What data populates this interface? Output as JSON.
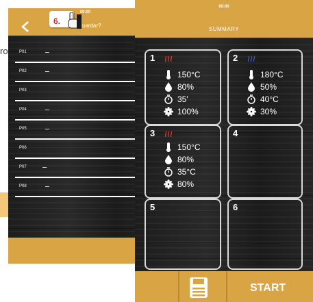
{
  "left_screen": {
    "time": "00:00",
    "title": "uardar?",
    "edge_text": "ro",
    "programs": [
      {
        "label": "P01",
        "value": "---"
      },
      {
        "label": "P02",
        "value": "---"
      },
      {
        "label": "P03",
        "value": ""
      },
      {
        "label": "P04",
        "value": "---"
      },
      {
        "label": "P05",
        "value": "---"
      },
      {
        "label": "P06",
        "value": ""
      },
      {
        "label": "P07",
        "value": "---"
      },
      {
        "label": "P08",
        "value": "---"
      }
    ]
  },
  "step_annotation": "6.",
  "right_screen": {
    "time": "00:00",
    "title": "SUMMARY",
    "phases": [
      {
        "number": "1",
        "mode": "heat",
        "temp": "150°C",
        "humidity": "80%",
        "time": "35'",
        "fan": "100%"
      },
      {
        "number": "2",
        "mode": "steam",
        "temp": "180°C",
        "humidity": "50%",
        "time": "40°C",
        "fan": "30%"
      },
      {
        "number": "3",
        "mode": "heat",
        "temp": "150°C",
        "humidity": "80%",
        "time": "35°C",
        "fan": "80%"
      },
      {
        "number": "4"
      },
      {
        "number": "5"
      },
      {
        "number": "6"
      }
    ],
    "footer": {
      "start_label": "START",
      "save_icon": "floppy-disk-icon"
    }
  },
  "colors": {
    "gold": "#d9a444",
    "heat": "#d63a2a",
    "steam": "#3a5ab8"
  }
}
